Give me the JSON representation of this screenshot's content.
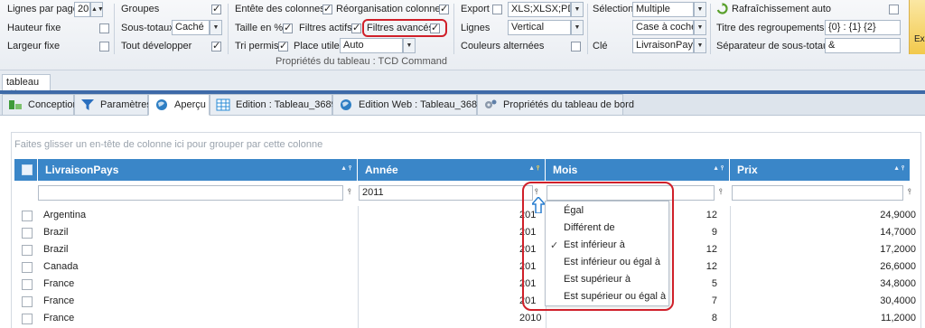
{
  "ribbon": {
    "lignes_par_page_label": "Lignes par page",
    "lignes_par_page_value": "20",
    "hauteur_fixe_label": "Hauteur fixe",
    "largeur_fixe_label": "Largeur fixe",
    "groupes_label": "Groupes",
    "sous_totaux_label": "Sous-totaux",
    "sous_totaux_value": "Caché",
    "tout_developper_label": "Tout développer",
    "entete_colonnes_label": "Entête des colonnes",
    "reorganisation_label": "Réorganisation colonnes",
    "taille_pct_label": "Taille en %",
    "filtres_actifs_label": "Filtres actifs",
    "filtres_avances_label": "Filtres avancés",
    "tri_permis_label": "Tri permis",
    "place_utile_label": "Place utile",
    "place_utile_value": "Auto",
    "group_caption": "Propriétés du tableau : TCD Command",
    "export_label": "Export",
    "export_value": "XLS;XLSX;PDF;",
    "lignes_label": "Lignes",
    "lignes_value": "Vertical",
    "couleurs_label": "Couleurs alternées",
    "selection_label": "Sélection",
    "selection_value": "Multiple",
    "selection_mode_value": "Case à cocher",
    "cle_label": "Clé",
    "cle_value": "LivraisonPays",
    "rafraichissement_label": "Rafraîchissement auto",
    "titre_regroupements_label": "Titre des regroupements",
    "titre_regroupements_value": "{0} : {1} {2}",
    "separateur_label": "Séparateur de sous-totaux",
    "separateur_value": "&",
    "cut_label": "Ex"
  },
  "doc_tab": {
    "label": "tableau",
    "close": "✕"
  },
  "tabs": [
    {
      "label": "Conception"
    },
    {
      "label": "Paramètres"
    },
    {
      "label": "Aperçu"
    },
    {
      "label": "Edition : Tableau_368914"
    },
    {
      "label": "Edition Web : Tableau_368914"
    },
    {
      "label": "Propriétés du tableau de bord"
    }
  ],
  "grid": {
    "group_hint": "Faites glisser un en-tête de colonne ici pour grouper par cette colonne",
    "columns": [
      "LivraisonPays",
      "Année",
      "Mois",
      "Prix"
    ],
    "filter_annee": "2011",
    "rows": [
      {
        "pays": "Argentina",
        "annee": "201",
        "mois": "12",
        "prix": "24,9000"
      },
      {
        "pays": "Brazil",
        "annee": "201",
        "mois": "9",
        "prix": "14,7000"
      },
      {
        "pays": "Brazil",
        "annee": "201",
        "mois": "12",
        "prix": "17,2000"
      },
      {
        "pays": "Canada",
        "annee": "201",
        "mois": "12",
        "prix": "26,6000"
      },
      {
        "pays": "France",
        "annee": "201",
        "mois": "5",
        "prix": "34,8000"
      },
      {
        "pays": "France",
        "annee": "201",
        "mois": "7",
        "prix": "30,4000"
      },
      {
        "pays": "France",
        "annee": "2010",
        "mois": "8",
        "prix": "11,2000"
      }
    ]
  },
  "filter_menu": {
    "items": [
      "Égal",
      "Différent de",
      "Est inférieur à",
      "Est inférieur ou égal à",
      "Est supérieur à",
      "Est supérieur ou égal à"
    ],
    "checked_item": "Est inférieur à"
  },
  "colors": {
    "header_blue": "#3a86c8",
    "highlight_red": "#d0202a"
  }
}
